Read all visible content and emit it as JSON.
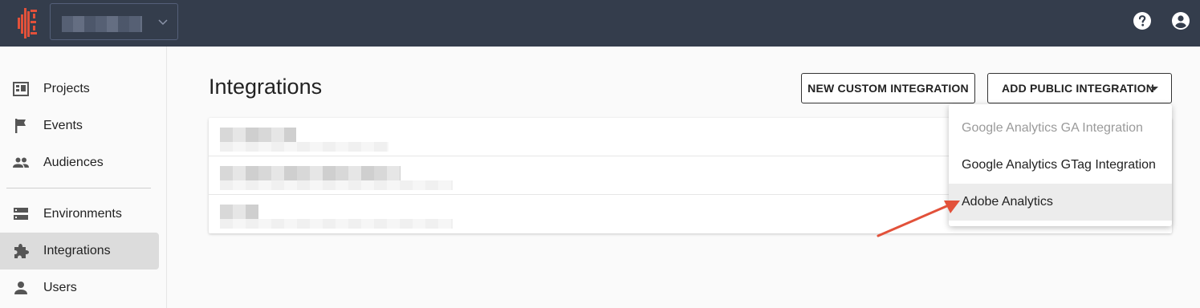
{
  "colors": {
    "topbar": "#343d4c",
    "accent": "#e2513a",
    "active_nav": "#dcdcdc",
    "annotation_arrow": "#e2513a"
  },
  "header": {
    "logo_icon": "brand-logo-icon",
    "help_icon": "help-circle-icon",
    "account_icon": "account-circle-icon"
  },
  "sidebar": {
    "items": [
      {
        "label": "Projects",
        "icon": "projects-icon"
      },
      {
        "label": "Events",
        "icon": "flag-icon"
      },
      {
        "label": "Audiences",
        "icon": "people-icon"
      },
      {
        "label": "Environments",
        "icon": "storage-icon"
      },
      {
        "label": "Integrations",
        "icon": "puzzle-icon",
        "active": true
      },
      {
        "label": "Users",
        "icon": "person-icon"
      }
    ]
  },
  "main": {
    "title": "Integrations",
    "buttons": {
      "new_custom": "NEW CUSTOM INTEGRATION",
      "add_public": "ADD PUBLIC INTEGRATION"
    }
  },
  "dropdown": {
    "items": [
      {
        "label": "Google Analytics GA Integration",
        "disabled": true
      },
      {
        "label": "Google Analytics GTag Integration",
        "disabled": false
      },
      {
        "label": "Adobe Analytics",
        "disabled": false,
        "highlighted": true
      }
    ]
  }
}
